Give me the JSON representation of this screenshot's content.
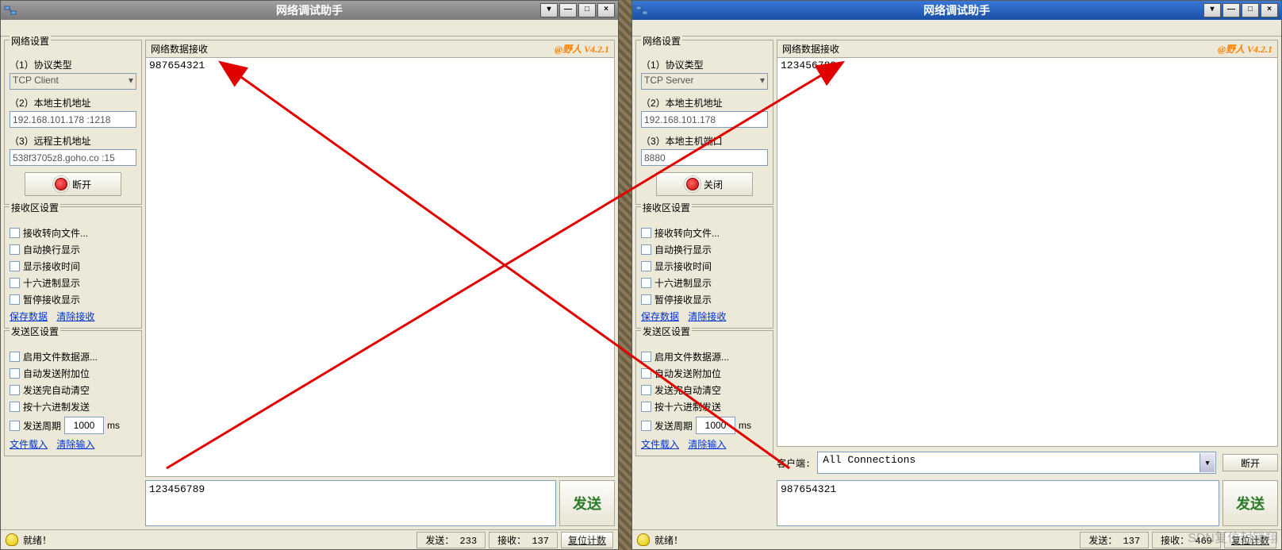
{
  "common": {
    "app_title": "网络调试助手",
    "brand": "@野人 V4.2.1",
    "net_settings_legend": "网络设置",
    "recv_settings_legend": "接收区设置",
    "send_settings_legend": "发送区设置",
    "recv_header": "网络数据接收",
    "label_protocol": "（1）协议类型",
    "recv_checks": [
      "接收转向文件...",
      "自动换行显示",
      "显示接收时间",
      "十六进制显示",
      "暂停接收显示"
    ],
    "send_checks": [
      "启用文件数据源...",
      "自动发送附加位",
      "发送完自动清空",
      "按十六进制发送"
    ],
    "cycle_label": "发送周期",
    "cycle_value": "1000",
    "cycle_unit": "ms",
    "links_recv": [
      "保存数据",
      "清除接收"
    ],
    "links_send": [
      "文件载入",
      "清除输入"
    ],
    "status_ready": "就绪！",
    "status_send_label": "发送：",
    "status_recv_label": "接收：",
    "reset_counter": "复位计数",
    "send_btn": "发送",
    "win_extra": "▾",
    "win_min": "—",
    "win_max": "□",
    "win_close": "×"
  },
  "left": {
    "protocol": "TCP Client",
    "label_host": "（2）本地主机地址",
    "host": "192.168.101.178 :1218",
    "label_remote": "（3）远程主机地址",
    "remote": "538f3705z8.goho.co :15",
    "action_btn": "断开",
    "recv_text": "987654321",
    "send_text": "123456789",
    "sent_count": "233",
    "recv_count": "137"
  },
  "right": {
    "protocol": "TCP Server",
    "label_host": "（2）本地主机地址",
    "host": "192.168.101.178",
    "label_port": "（3）本地主机端口",
    "port": "8880",
    "action_btn": "关闭",
    "recv_text": "123456789",
    "client_label": "客户端:",
    "client_combo": "All Connections",
    "disconnect_btn": "断开",
    "send_text": "987654321",
    "sent_count": "137",
    "recv_count": "469",
    "watermark": "SDN复位封锁翔"
  }
}
